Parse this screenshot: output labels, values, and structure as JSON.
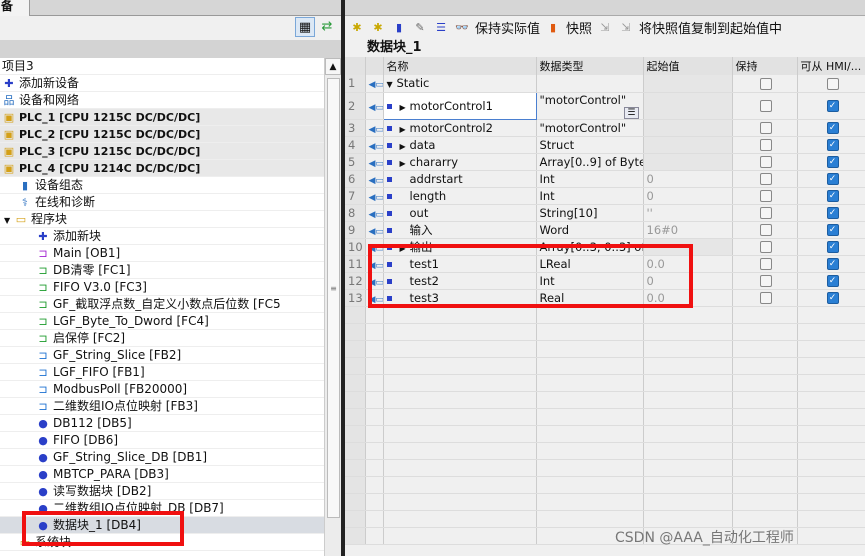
{
  "left": {
    "tab": "备",
    "tree": [
      {
        "label": "项目3",
        "icon": "project-icon",
        "kind": "root"
      },
      {
        "label": "添加新设备",
        "icon": "add-device-icon"
      },
      {
        "label": "设备和网络",
        "icon": "network-icon"
      },
      {
        "label": "PLC_1 [CPU 1215C DC/DC/DC]",
        "icon": "plc-folder-icon",
        "kind": "dev"
      },
      {
        "label": "PLC_2 [CPU 1215C DC/DC/DC]",
        "icon": "plc-folder-icon",
        "kind": "dev"
      },
      {
        "label": "PLC_3 [CPU 1215C DC/DC/DC]",
        "icon": "plc-folder-icon",
        "kind": "dev"
      },
      {
        "label": "PLC_4 [CPU 1214C DC/DC/DC]",
        "icon": "plc-folder-icon",
        "kind": "dev"
      },
      {
        "label": "设备组态",
        "icon": "device-config-icon",
        "indent": 1
      },
      {
        "label": "在线和诊断",
        "icon": "diagnostics-icon",
        "indent": 1
      },
      {
        "label": "程序块",
        "icon": "folder-icon",
        "indent": 0,
        "expanded": true
      },
      {
        "label": "添加新块",
        "icon": "add-block-icon",
        "indent": 2
      },
      {
        "label": "Main [OB1]",
        "icon": "ob-icon",
        "indent": 2
      },
      {
        "label": "DB清零 [FC1]",
        "icon": "fc-icon",
        "indent": 2
      },
      {
        "label": "FIFO V3.0 [FC3]",
        "icon": "fc-icon",
        "indent": 2
      },
      {
        "label": "GF_截取浮点数_自定义小数点后位数 [FC5",
        "icon": "fc-icon",
        "indent": 2
      },
      {
        "label": "LGF_Byte_To_Dword [FC4]",
        "icon": "fc-icon",
        "indent": 2
      },
      {
        "label": "启保停 [FC2]",
        "icon": "fc-icon",
        "indent": 2
      },
      {
        "label": "GF_String_Slice [FB2]",
        "icon": "fb-icon",
        "indent": 2
      },
      {
        "label": "LGF_FIFO [FB1]",
        "icon": "fb-icon",
        "indent": 2
      },
      {
        "label": "ModbusPoll [FB20000]",
        "icon": "fb-icon",
        "indent": 2
      },
      {
        "label": "二维数组IO点位映射 [FB3]",
        "icon": "fb-icon",
        "indent": 2
      },
      {
        "label": "DB112 [DB5]",
        "icon": "db-icon",
        "indent": 2
      },
      {
        "label": "FIFO [DB6]",
        "icon": "db-icon",
        "indent": 2
      },
      {
        "label": "GF_String_Slice_DB [DB1]",
        "icon": "db-icon",
        "indent": 2
      },
      {
        "label": "MBTCP_PARA [DB3]",
        "icon": "db-icon",
        "indent": 2
      },
      {
        "label": "读写数据块 [DB2]",
        "icon": "db-icon",
        "indent": 2
      },
      {
        "label": "二维数组IO点位映射_DB [DB7]",
        "icon": "db-icon",
        "indent": 2
      },
      {
        "label": "数据块_1 [DB4]",
        "icon": "db-icon",
        "indent": 2,
        "selected": true
      },
      {
        "label": "系统块",
        "icon": "folder-icon",
        "indent": 1
      }
    ]
  },
  "toolbar": {
    "keep_actual": "保持实际值",
    "snapshot": "快照",
    "copy_snapshot": "将快照值复制到起始值中"
  },
  "block_title": "数据块_1",
  "columns": [
    "名称",
    "数据类型",
    "起始值",
    "保持",
    "可从 HMI/..."
  ],
  "rows": [
    {
      "n": "1",
      "name": "Static",
      "type": "",
      "start": "",
      "retain": false,
      "hmi": false,
      "expand": "down",
      "static": true
    },
    {
      "n": "2",
      "name": "motorControl1",
      "type": "\"motorControl\"",
      "start": "",
      "retain": false,
      "hmi": true,
      "expand": "right"
    },
    {
      "n": "3",
      "name": "motorControl2",
      "type": "\"motorControl\"",
      "start": "",
      "retain": false,
      "hmi": true,
      "expand": "right"
    },
    {
      "n": "4",
      "name": "data",
      "type": "Struct",
      "start": "",
      "retain": false,
      "hmi": true,
      "expand": "right"
    },
    {
      "n": "5",
      "name": "chararry",
      "type": "Array[0..9] of Byte",
      "start": "",
      "retain": false,
      "hmi": true,
      "expand": "right"
    },
    {
      "n": "6",
      "name": "addrstart",
      "type": "Int",
      "start": "0",
      "retain": false,
      "hmi": true
    },
    {
      "n": "7",
      "name": "length",
      "type": "Int",
      "start": "0",
      "retain": false,
      "hmi": true
    },
    {
      "n": "8",
      "name": "out",
      "type": "String[10]",
      "start": "''",
      "retain": false,
      "hmi": true
    },
    {
      "n": "9",
      "name": "输入",
      "type": "Word",
      "start": "16#0",
      "retain": false,
      "hmi": true
    },
    {
      "n": "10",
      "name": "输出",
      "type": "Array[0..3, 0..3] of ...",
      "start": "",
      "retain": false,
      "hmi": true,
      "expand": "right"
    },
    {
      "n": "11",
      "name": "test1",
      "type": "LReal",
      "start": "0.0",
      "retain": false,
      "hmi": true
    },
    {
      "n": "12",
      "name": "test2",
      "type": "Int",
      "start": "0",
      "retain": false,
      "hmi": true
    },
    {
      "n": "13",
      "name": "test3",
      "type": "Real",
      "start": "0.0",
      "retain": false,
      "hmi": true
    }
  ],
  "watermark": "CSDN @AAA_自动化工程师",
  "colors": {
    "highlight": "#f01010",
    "checkbox": "#2a7fd4"
  }
}
